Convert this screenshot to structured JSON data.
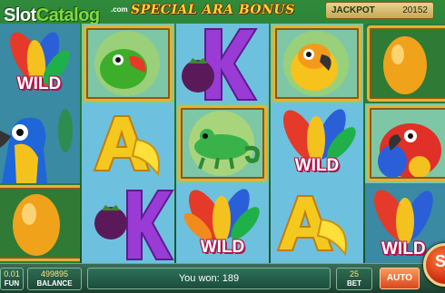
{
  "header": {
    "logo_part1": "Slot",
    "logo_part2": "Catalog",
    "logo_suffix": ".com",
    "game_title": "SPECIAL ARA BONUS",
    "jackpot_label": "JACKPOT",
    "jackpot_value": "20152"
  },
  "reels": [
    {
      "symbols": [
        "wild-feathers-icon",
        "macaw-blue-yellow-icon",
        "golden-egg-icon"
      ],
      "wild_label": "WILD",
      "dim": true
    },
    {
      "symbols": [
        "green-parrot-icon",
        "letter-a-banana-icon",
        "letter-k-mangosteen-icon"
      ],
      "dim": false
    },
    {
      "symbols": [
        "letter-k-mangosteen-icon",
        "chameleon-icon",
        "wild-feathers-icon"
      ],
      "wild_label": "WILD",
      "dim": false
    },
    {
      "symbols": [
        "yellow-parrot-icon",
        "wild-feathers-icon",
        "letter-a-banana-icon"
      ],
      "wild_label": "WILD",
      "dim": false
    },
    {
      "symbols": [
        "golden-egg-icon",
        "scarlet-macaw-icon",
        "wild-feathers-icon"
      ],
      "wild_label": "WILD",
      "dim": true
    }
  ],
  "colors": {
    "wild_outline": "#b0154a",
    "title": "#ffd23a",
    "reel_bg": "#6dc1de"
  },
  "bottom": {
    "coin_value": "0.01",
    "coin_label": "FUN",
    "balance_value": "499895",
    "balance_label": "BALANCE",
    "win_text": "You won: 189",
    "bet_value": "25",
    "bet_label": "BET",
    "auto_label": "AUTO",
    "spin_glyph": "S"
  }
}
